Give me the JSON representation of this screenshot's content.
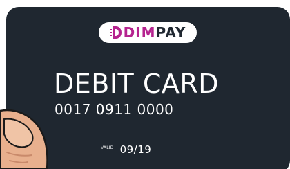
{
  "card": {
    "logo": {
      "brand": "DIM",
      "suffix": "PAY",
      "icon": "dimpay-d-glyph-icon"
    },
    "title": "DEBIT CARD",
    "number": "0017 0911 0000",
    "valid_label": "VALID",
    "valid_date": "09/19"
  },
  "colors": {
    "card_background": "#1f2730",
    "brand_magenta": "#b5238f",
    "text": "#ffffff",
    "skin": "#e8b08e",
    "skin_shadow": "#c98a6b"
  }
}
